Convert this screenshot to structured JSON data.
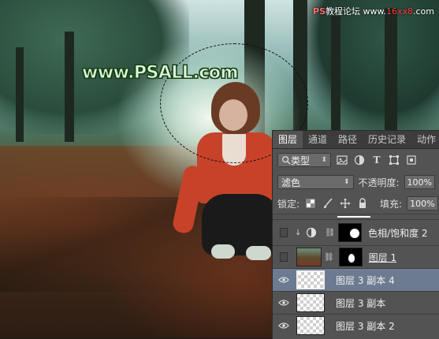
{
  "watermark": {
    "top_right_text_1": "PS",
    "top_right_text_2": "教程论坛",
    "top_right_text_3": "www.",
    "top_right_text_4": "16xx8",
    "top_right_text_5": ".com",
    "site": "www.PSALL.com"
  },
  "layers_panel": {
    "tabs": [
      {
        "label": "图层",
        "active": true
      },
      {
        "label": "通道",
        "active": false
      },
      {
        "label": "路径",
        "active": false
      },
      {
        "label": "历史记录",
        "active": false
      },
      {
        "label": "动作",
        "active": false
      }
    ],
    "filter": {
      "label": "类型",
      "icon": "search-icon"
    },
    "blend_mode": "滤色",
    "opacity_label": "不透明度:",
    "opacity_value": "100%",
    "lock_label": "锁定:",
    "fill_label": "填充:",
    "fill_value": "100%",
    "layers": [
      {
        "name": "色相/饱和度 2",
        "visible": false,
        "type": "adjustment",
        "selected": false
      },
      {
        "name": "图层 1",
        "visible": false,
        "type": "photo",
        "selected": false
      },
      {
        "name": "图层 3 副本 4",
        "visible": true,
        "type": "transparent",
        "selected": true
      },
      {
        "name": "图层 3 副本",
        "visible": true,
        "type": "transparent",
        "selected": false
      },
      {
        "name": "图层 3 副本 2",
        "visible": true,
        "type": "transparent",
        "selected": false
      }
    ]
  }
}
